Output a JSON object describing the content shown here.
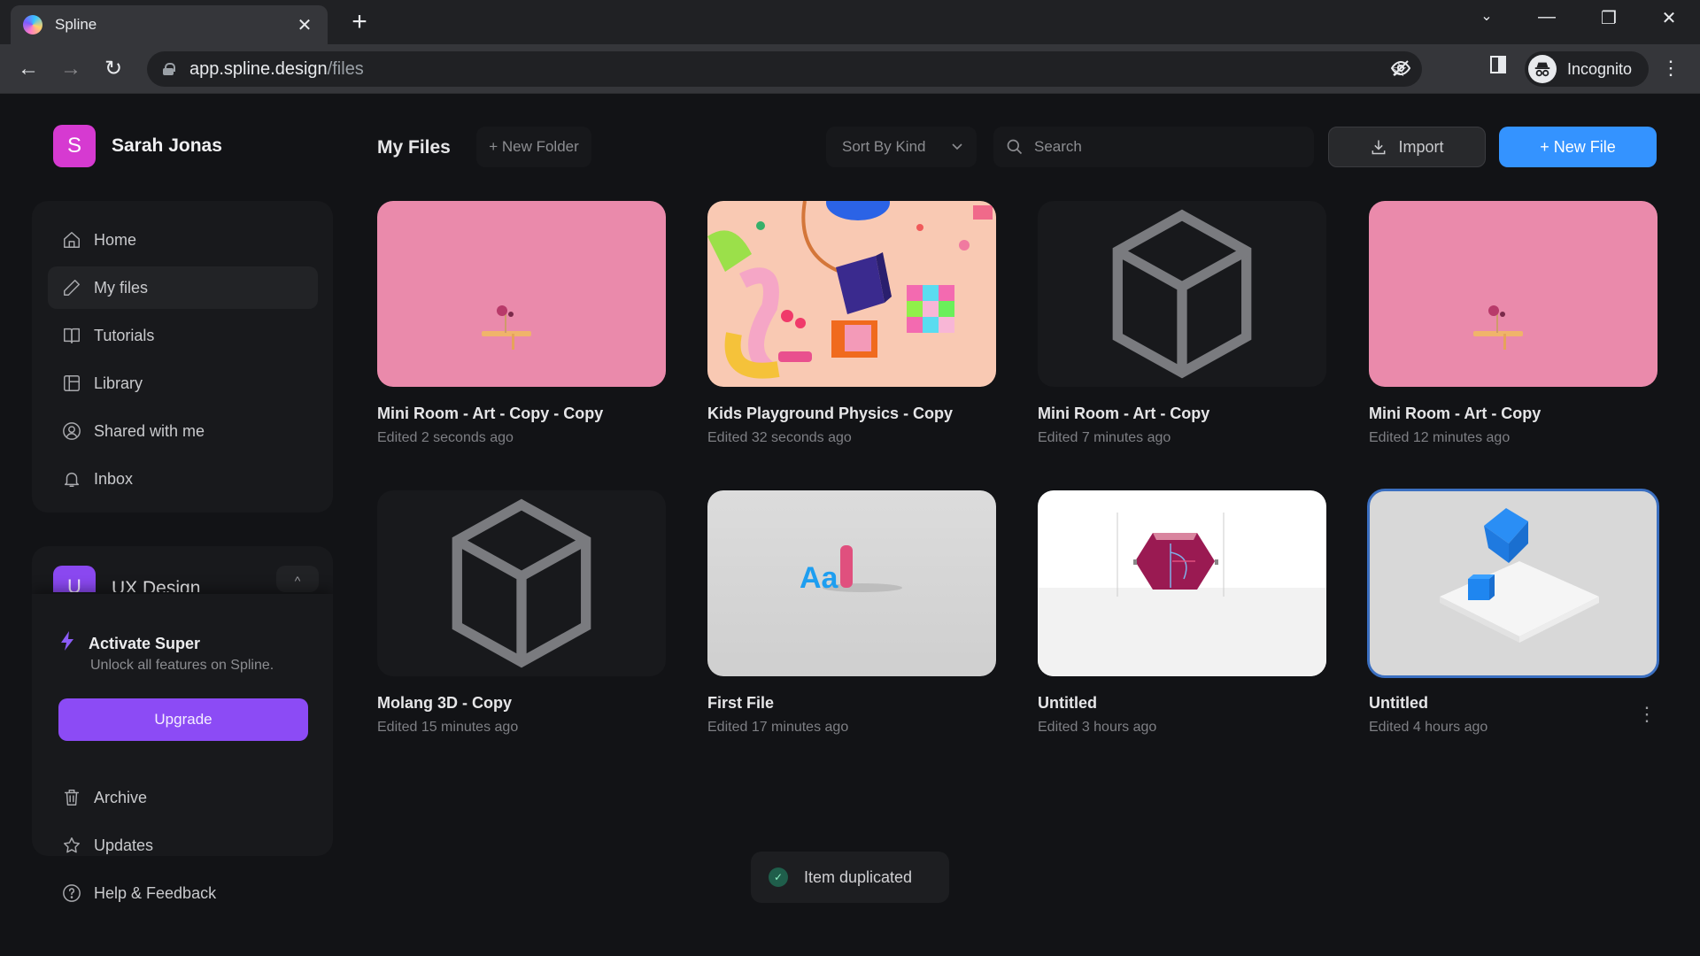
{
  "browser": {
    "tab_title": "Spline",
    "tab_close": "✕",
    "new_tab": "+",
    "url_host": "app.spline.design",
    "url_path": "/files",
    "profile_label": "Incognito",
    "back_icon": "←",
    "forward_icon": "→",
    "reload_icon": "↻",
    "tab_search_icon": "⌄",
    "minimize_icon": "—",
    "restore_icon": "❐",
    "close_icon": "✕",
    "eye_off_icon": "◎",
    "star_icon": "☆",
    "side_panel_icon": "▮",
    "menu_icon": "⋮"
  },
  "user": {
    "initial": "S",
    "name": "Sarah Jonas",
    "avatar_color": "#d63ad1"
  },
  "sidebar": {
    "items": [
      {
        "label": "Home",
        "icon": "home-icon",
        "active": false
      },
      {
        "label": "My files",
        "icon": "pencil-icon",
        "active": true
      },
      {
        "label": "Tutorials",
        "icon": "book-icon",
        "active": false
      },
      {
        "label": "Library",
        "icon": "layout-icon",
        "active": false
      },
      {
        "label": "Shared with me",
        "icon": "user-circle-icon",
        "active": false
      },
      {
        "label": "Inbox",
        "icon": "bell-icon",
        "active": false
      }
    ],
    "team": {
      "initial": "U",
      "name": "UX Design",
      "toggle_icon": "^"
    },
    "promo": {
      "title": "Activate Super",
      "subtitle": "Unlock all features on Spline.",
      "button": "Upgrade",
      "accent": "#8c4bf5"
    },
    "bottom_items": [
      {
        "label": "Archive",
        "icon": "trash-icon"
      },
      {
        "label": "Updates",
        "icon": "star-icon"
      },
      {
        "label": "Help & Feedback",
        "icon": "help-icon"
      }
    ]
  },
  "toolbar": {
    "title": "My Files",
    "new_folder": "+ New Folder",
    "sort_label": "Sort By Kind",
    "search_placeholder": "Search",
    "search_value": "",
    "import_label": "Import",
    "new_file_label": "+ New File",
    "accent": "#3493ff"
  },
  "files": [
    {
      "title": "Mini Room - Art - Copy - Copy",
      "edited": "Edited 2 seconds ago",
      "thumb": "mini-room"
    },
    {
      "title": "Kids Playground Physics - Copy",
      "edited": "Edited 32 seconds ago",
      "thumb": "playground"
    },
    {
      "title": "Mini Room - Art - Copy",
      "edited": "Edited 7 minutes ago",
      "thumb": "empty"
    },
    {
      "title": "Mini Room - Art - Copy",
      "edited": "Edited 12 minutes ago",
      "thumb": "mini-room"
    },
    {
      "title": "Molang 3D - Copy",
      "edited": "Edited 15 minutes ago",
      "thumb": "empty"
    },
    {
      "title": "First File",
      "edited": "Edited 17 minutes ago",
      "thumb": "first-file"
    },
    {
      "title": "Untitled",
      "edited": "Edited 3 hours ago",
      "thumb": "hexagon"
    },
    {
      "title": "Untitled",
      "edited": "Edited 4 hours ago",
      "thumb": "cubes",
      "selected": true,
      "menu_icon": "⋮"
    }
  ],
  "toast": {
    "check": "✓",
    "text": "Item duplicated"
  }
}
